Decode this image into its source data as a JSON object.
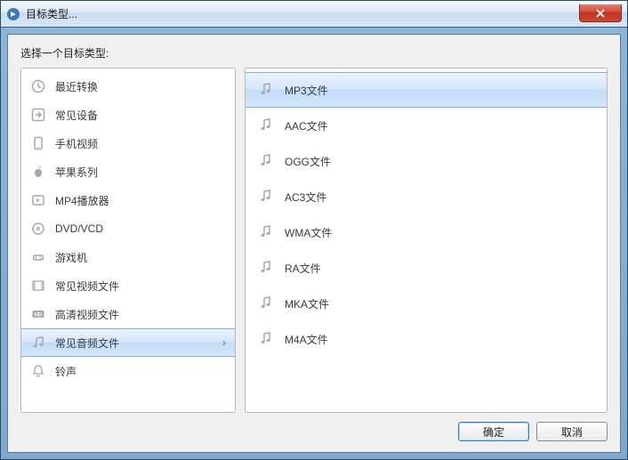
{
  "window": {
    "title": "目标类型..."
  },
  "instruction": "选择一个目标类型:",
  "categories": [
    {
      "icon": "clock",
      "label": "最近转换",
      "selected": false
    },
    {
      "icon": "arrow",
      "label": "常见设备",
      "selected": false
    },
    {
      "icon": "phone",
      "label": "手机视频",
      "selected": false
    },
    {
      "icon": "apple",
      "label": "苹果系列",
      "selected": false
    },
    {
      "icon": "mp4",
      "label": "MP4播放器",
      "selected": false
    },
    {
      "icon": "disc",
      "label": "DVD/VCD",
      "selected": false
    },
    {
      "icon": "gamepad",
      "label": "游戏机",
      "selected": false
    },
    {
      "icon": "film",
      "label": "常见视频文件",
      "selected": false
    },
    {
      "icon": "hd",
      "label": "高清视频文件",
      "selected": false
    },
    {
      "icon": "music",
      "label": "常见音频文件",
      "selected": true
    },
    {
      "icon": "bell",
      "label": "铃声",
      "selected": false
    }
  ],
  "formats": [
    {
      "label": "MP3文件",
      "selected": true
    },
    {
      "label": "AAC文件",
      "selected": false
    },
    {
      "label": "OGG文件",
      "selected": false
    },
    {
      "label": "AC3文件",
      "selected": false
    },
    {
      "label": "WMA文件",
      "selected": false
    },
    {
      "label": "RA文件",
      "selected": false
    },
    {
      "label": "MKA文件",
      "selected": false
    },
    {
      "label": "M4A文件",
      "selected": false
    }
  ],
  "buttons": {
    "ok": "确定",
    "cancel": "取消"
  }
}
